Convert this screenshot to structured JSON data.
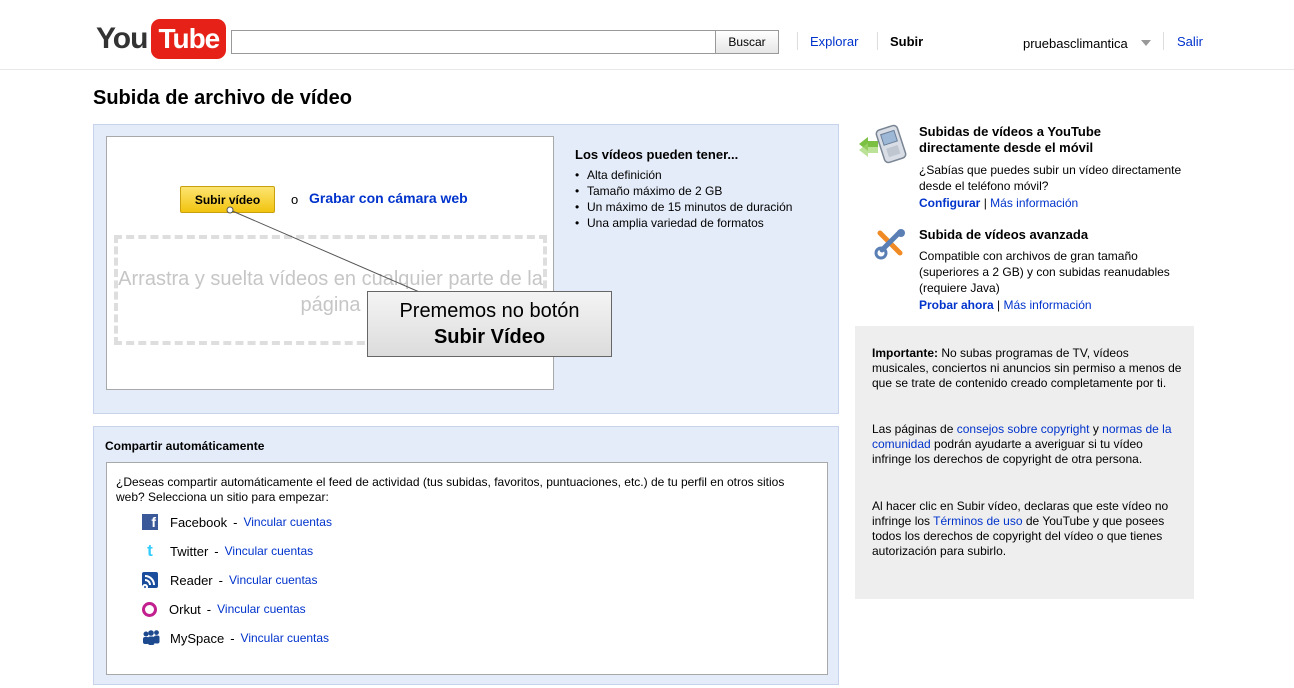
{
  "header": {
    "logo_you": "You",
    "logo_tube": "Tube",
    "search_value": "",
    "search_button": "Buscar",
    "nav_explore": "Explorar",
    "nav_upload": "Subir",
    "username": "pruebasclimantica",
    "logout": "Salir"
  },
  "page_title": "Subida de archivo de vídeo",
  "upload": {
    "button": "Subir vídeo",
    "or": "o",
    "webcam_link": "Grabar con cámara web",
    "drop_text": "Arrastra y suelta vídeos en cualquier parte de la página",
    "callout_line1": "Prememos no botón",
    "callout_line2": "Subir Vídeo",
    "features_heading": "Los vídeos pueden tener...",
    "features": [
      "Alta definición",
      "Tamaño máximo de 2 GB",
      "Un máximo de 15 minutos de duración",
      "Una amplia variedad de formatos"
    ]
  },
  "share": {
    "heading": "Compartir automáticamente",
    "description": "¿Deseas compartir automáticamente el feed de actividad (tus subidas, favoritos, puntuaciones, etc.) de tu perfil en otros sitios web? Selecciona un sitio para empezar:",
    "separator": "-",
    "services": [
      {
        "name": "Facebook",
        "action": "Vincular cuentas",
        "icon": "facebook-icon"
      },
      {
        "name": "Twitter",
        "action": "Vincular cuentas",
        "icon": "twitter-icon"
      },
      {
        "name": "Reader",
        "action": "Vincular cuentas",
        "icon": "reader-icon"
      },
      {
        "name": "Orkut",
        "action": "Vincular cuentas",
        "icon": "orkut-icon"
      },
      {
        "name": "MySpace",
        "action": "Vincular cuentas",
        "icon": "myspace-icon"
      }
    ]
  },
  "sidebar": {
    "mobile_title": "Subidas de vídeos a YouTube directamente desde el móvil",
    "mobile_text": "¿Sabías que puedes subir un vídeo directamente desde el teléfono móvil?",
    "mobile_link1": "Configurar",
    "mobile_link2": "Más información",
    "advanced_title": "Subida de vídeos avanzada",
    "advanced_text": "Compatible con archivos de gran tamaño (superiores a 2 GB) y con subidas reanudables (requiere Java)",
    "advanced_link1": "Probar ahora",
    "advanced_link2": "Más información",
    "link_separator": "|",
    "notice": {
      "p1_bold": "Importante:",
      "p1_text": " No subas programas de TV, vídeos musicales, conciertos ni anuncios sin permiso a menos de que se trate de contenido creado completamente por ti.",
      "p2_a": "Las páginas de ",
      "p2_link1": "consejos sobre copyright",
      "p2_b": " y ",
      "p2_link2": "normas de la comunidad",
      "p2_c": " podrán ayudarte a averiguar si tu vídeo infringe los derechos de copyright de otra persona.",
      "p3_a": "Al hacer clic en Subir vídeo, declaras que este vídeo no infringe los ",
      "p3_link": "Términos de uso",
      "p3_b": " de YouTube y que posees todos los derechos de copyright del vídeo o que tienes autorización para subirlo."
    }
  },
  "colors": {
    "panel_bg": "#e5ecf9",
    "link": "#0033cc",
    "upload_button": "#f2c40f",
    "logo_red": "#e62117"
  }
}
